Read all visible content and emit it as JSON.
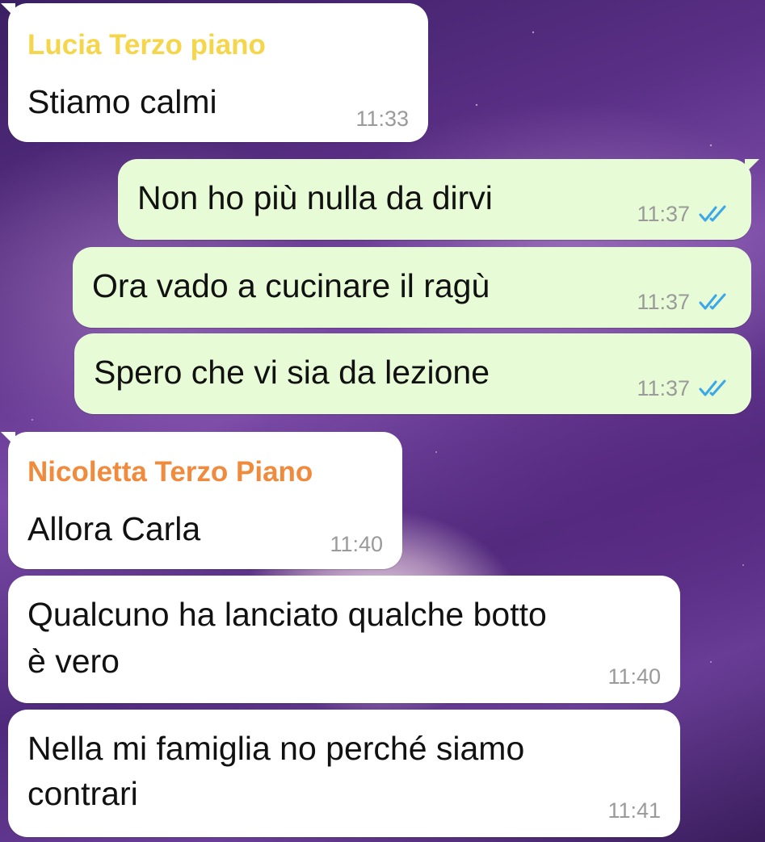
{
  "colors": {
    "incoming_bubble": "#ffffff",
    "outgoing_bubble": "#e7fcd6",
    "sender_lucia": "#f5d54a",
    "sender_nicoletta": "#f08a3c",
    "timestamp": "#9a9a9a",
    "read_ticks": "#3aa7e8"
  },
  "messages": [
    {
      "direction": "incoming",
      "sender": "Lucia Terzo piano",
      "text": "Stiamo calmi",
      "time": "11:33"
    },
    {
      "direction": "outgoing",
      "text": "Non ho più nulla da dirvi",
      "time": "11:37",
      "status_icon": "double-check-read-icon"
    },
    {
      "direction": "outgoing",
      "text": "Ora vado a cucinare il ragù",
      "time": "11:37",
      "status_icon": "double-check-read-icon"
    },
    {
      "direction": "outgoing",
      "text": "Spero che vi sia da lezione",
      "time": "11:37",
      "status_icon": "double-check-read-icon"
    },
    {
      "direction": "incoming",
      "sender": "Nicoletta Terzo Piano",
      "text": "Allora Carla",
      "time": "11:40"
    },
    {
      "direction": "incoming",
      "text_lines": [
        "Qualcuno ha lanciato qualche botto",
        "è vero"
      ],
      "time": "11:40"
    },
    {
      "direction": "incoming",
      "text_lines": [
        "Nella mi famiglia no perché siamo",
        "contrari"
      ],
      "time": "11:41"
    }
  ]
}
